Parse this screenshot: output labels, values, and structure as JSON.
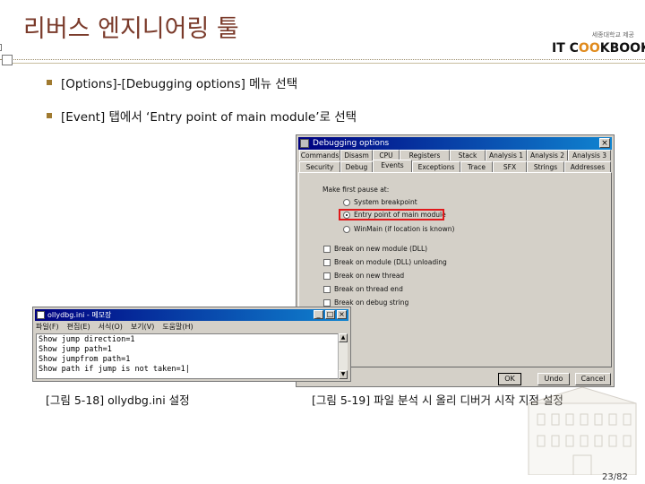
{
  "slide": {
    "title": "리버스 엔지니어링 툴",
    "logo_small": "세종대학교 제공",
    "logo_main_pre": "IT C",
    "logo_main_oo": "OO",
    "logo_main_post": "KBOOK",
    "bullets": [
      "[Options]-[Debugging options] 메뉴 선택",
      "[Event] 탭에서 ‘Entry point of main module’로 선택"
    ],
    "caption_left": "[그림 5-18] ollydbg.ini 설정",
    "caption_right": "[그림 5-19] 파일 분석 시 올리 디버거 시작 지점 설정",
    "page": "23/82"
  },
  "dialog": {
    "title": "Debugging options",
    "close": "×",
    "tabs_row1": [
      "Commands",
      "Disasm",
      "CPU",
      "Registers",
      "Stack",
      "Analysis 1",
      "Analysis 2",
      "Analysis 3"
    ],
    "tabs_row2": [
      "Security",
      "Debug",
      "Events",
      "Exceptions",
      "Trace",
      "SFX",
      "Strings",
      "Addresses"
    ],
    "group_label": "Make first pause at:",
    "radios": [
      "System breakpoint",
      "Entry point of main module",
      "WinMain (if location is known)"
    ],
    "checks": [
      "Break on new module (DLL)",
      "Break on module (DLL) unloading",
      "Break on new thread",
      "Break on thread end",
      "Break on debug string"
    ],
    "buttons": [
      "OK",
      "Undo",
      "Cancel"
    ]
  },
  "notepad": {
    "title": "ollydbg.ini - 메모장",
    "menu": [
      "파일(F)",
      "편집(E)",
      "서식(O)",
      "보기(V)",
      "도움말(H)"
    ],
    "lines": [
      "Show jump direction=1",
      "Show jump path=1",
      "Show jumpfrom path=1",
      "Show path if jump is not taken=1|"
    ],
    "min": "_",
    "max": "□",
    "close": "×"
  }
}
